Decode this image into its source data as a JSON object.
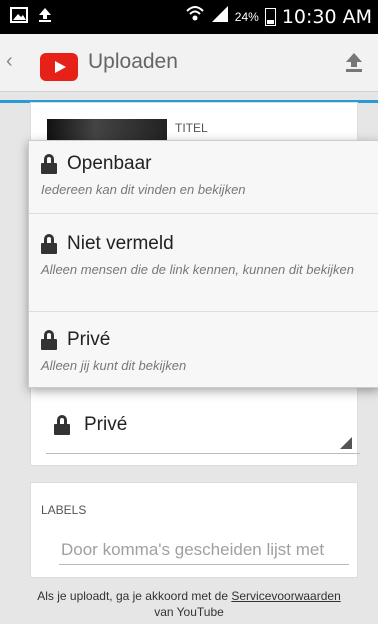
{
  "status_bar": {
    "battery": "24%",
    "time": "10:30 AM"
  },
  "app_bar": {
    "title": "Uploaden"
  },
  "video": {
    "title_label": "TITEL"
  },
  "privacy_options": [
    {
      "label": "Openbaar",
      "description": "Iedereen kan dit vinden en bekijken"
    },
    {
      "label": "Niet vermeld",
      "description": "Alleen mensen die de link kennen, kunnen dit bekijken"
    },
    {
      "label": "Privé",
      "description": "Alleen jij kunt dit bekijken"
    }
  ],
  "privacy_select": {
    "selected": "Privé"
  },
  "labels": {
    "title": "LABELS",
    "placeholder": "Door komma's gescheiden lijst met"
  },
  "footer": {
    "text_before": "Als je uploadt, ga je akkoord met de ",
    "link": "Servicevoorwaarden",
    "text_after": "van YouTube"
  },
  "colors": {
    "accent": "#2a9ad4",
    "brand": "#e62117"
  }
}
